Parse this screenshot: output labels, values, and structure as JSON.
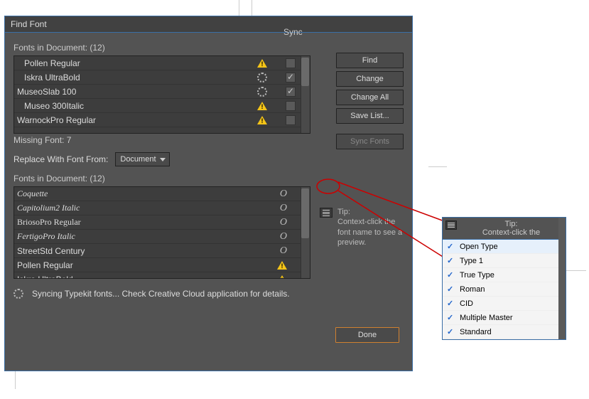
{
  "window": {
    "title": "Find Font"
  },
  "labels": {
    "fonts_in_doc": "Fonts in Document: (12)",
    "sync": "Sync",
    "missing": "Missing Font: 7",
    "replace_from": "Replace With Font From:",
    "fonts_in_doc2": "Fonts in Document: (12)",
    "status": "Syncing Typekit fonts... Check Creative Cloud application for details."
  },
  "dropdown": {
    "value": "Document"
  },
  "buttons": {
    "find": "Find",
    "change": "Change",
    "change_all": "Change All",
    "save_list": "Save List...",
    "sync_fonts": "Sync Fonts",
    "done": "Done"
  },
  "tip": {
    "head": "Tip:",
    "body": "Context-click the font name to see a preview."
  },
  "list1": [
    {
      "name": "Pollen Regular",
      "status": "warn",
      "sync_checked": false
    },
    {
      "name": "Iskra UltraBold",
      "status": "spin",
      "sync_checked": true
    },
    {
      "name": "MuseoSlab 100",
      "status": "spin",
      "sync_checked": true
    },
    {
      "name": "Museo 300Italic",
      "status": "warn",
      "sync_checked": false
    },
    {
      "name": "WarnockPro Regular",
      "status": "warn",
      "sync_checked": false
    }
  ],
  "list2": [
    {
      "name": "Coquette",
      "cls": "font-coquette",
      "status": "o"
    },
    {
      "name": "Capitolium2 Italic",
      "cls": "font-capitolium",
      "status": "o"
    },
    {
      "name": "BriosoPro Regular",
      "cls": "font-brioso",
      "status": "o"
    },
    {
      "name": "FertigoPro Italic",
      "cls": "font-fertigo",
      "status": "o"
    },
    {
      "name": "StreetStd Century",
      "cls": "",
      "status": "o"
    },
    {
      "name": "Pollen Regular",
      "cls": "font-pollen",
      "status": "warn"
    },
    {
      "name": "Iskra UltraBold",
      "cls": "",
      "status": "warn"
    }
  ],
  "flyout": {
    "tip_head": "Tip:",
    "tip_body": "Context-click the",
    "items": [
      "Open Type",
      "Type 1",
      "True Type",
      "Roman",
      "CID",
      "Multiple Master",
      "Standard"
    ]
  }
}
